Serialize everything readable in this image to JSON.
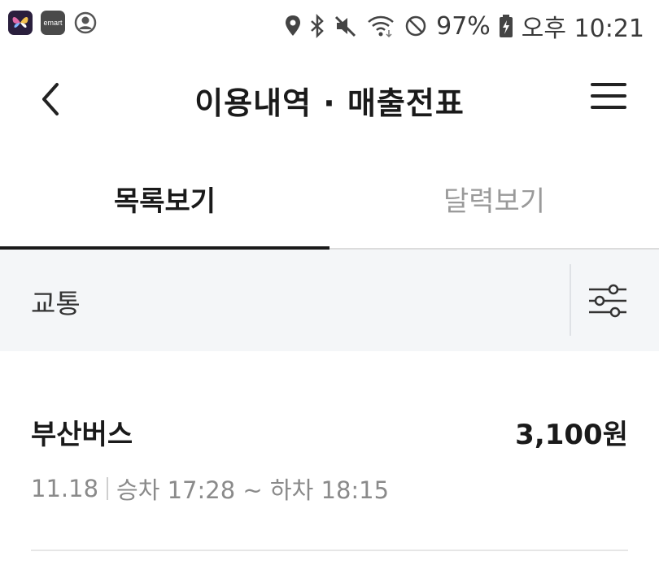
{
  "status_bar": {
    "emart_label": "emart",
    "battery": "97%",
    "time": "오후 10:21"
  },
  "header": {
    "title": "이용내역 · 매출전표"
  },
  "tabs": [
    {
      "label": "목록보기",
      "active": true
    },
    {
      "label": "달력보기",
      "active": false
    }
  ],
  "filter": {
    "label": "교통"
  },
  "transactions": [
    {
      "merchant": "부산버스",
      "amount": "3,100원",
      "date": "11.18",
      "detail": "승차 17:28 ~ 하차 18:15"
    }
  ],
  "colors": {
    "text_primary": "#1a1a1a",
    "text_muted": "#8a8a8a",
    "filter_bg": "#f4f6f8",
    "tab_indicator": "#1a1a1a"
  }
}
